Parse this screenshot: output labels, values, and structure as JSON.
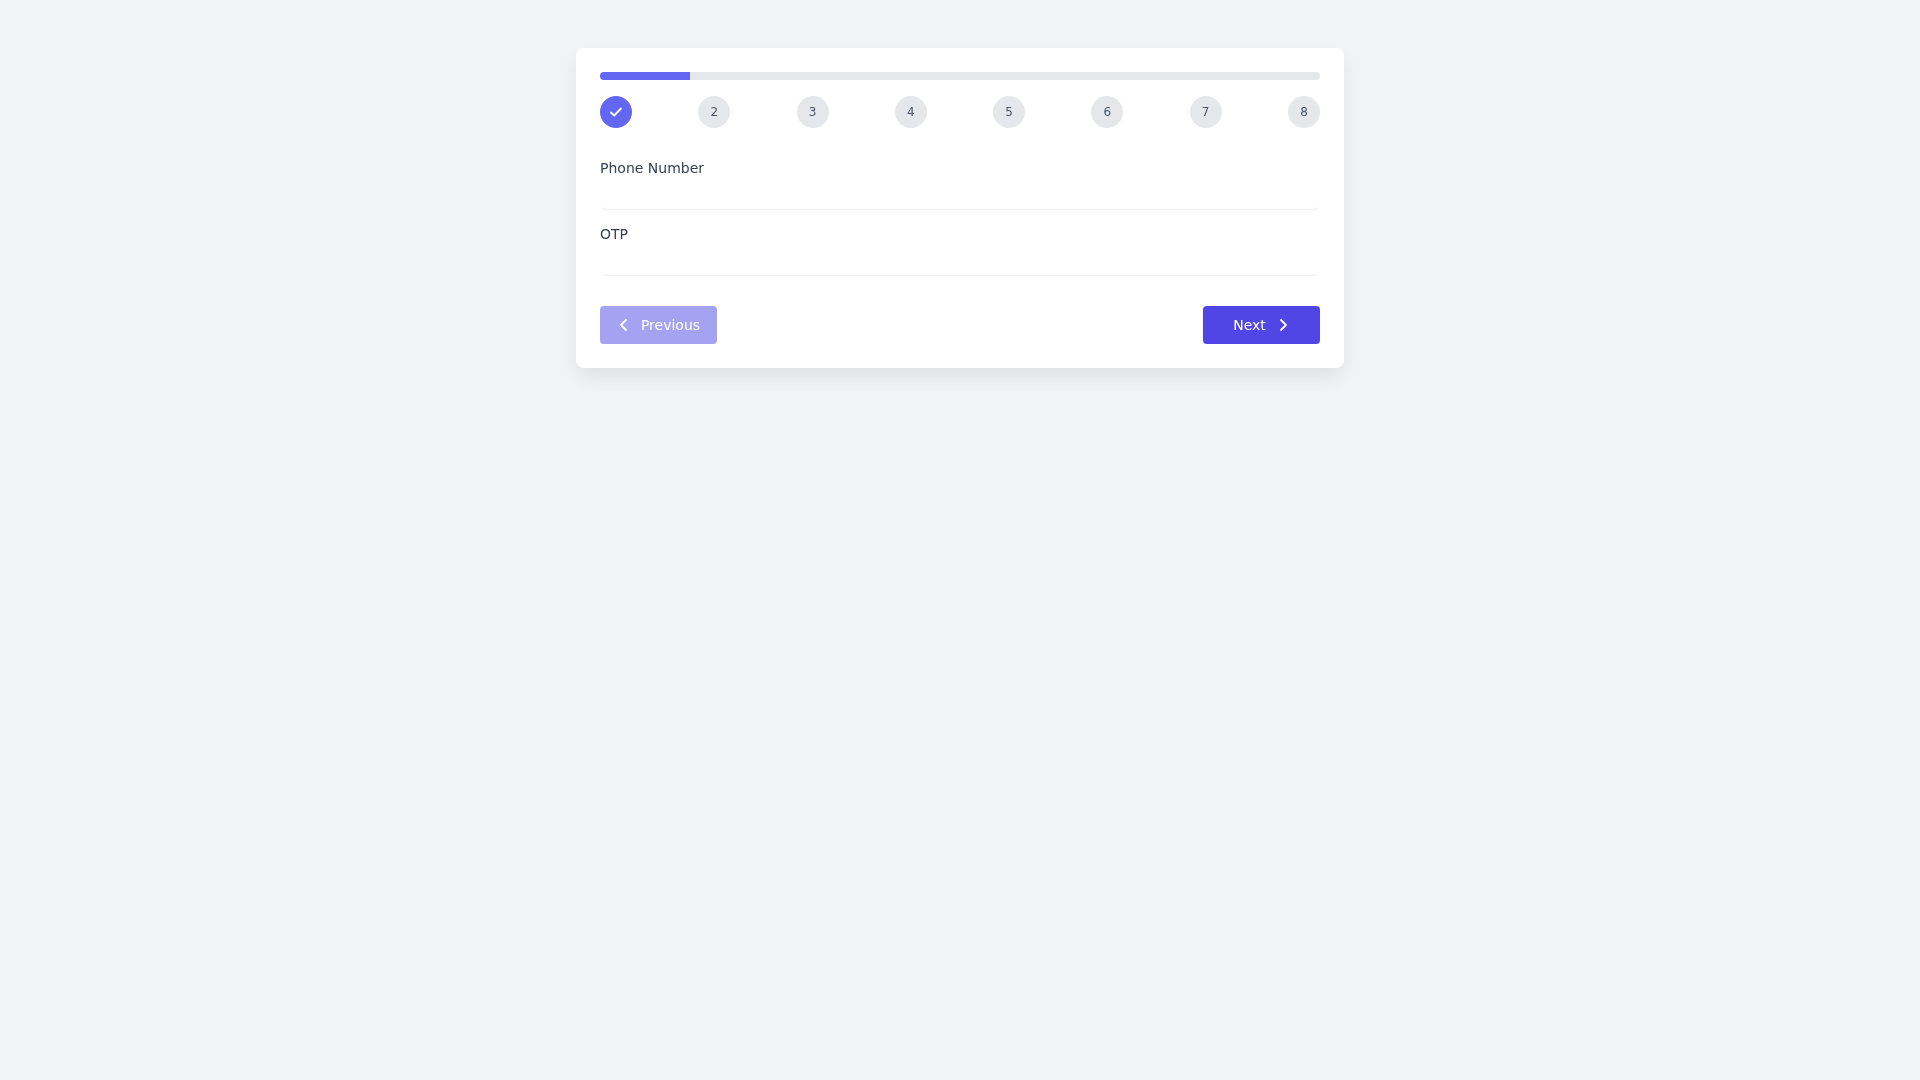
{
  "progress": {
    "level": 0.125
  },
  "steps": [
    {
      "completed": true
    },
    {
      "label": "2",
      "completed": false
    },
    {
      "label": "3",
      "completed": false
    },
    {
      "label": "4",
      "completed": false
    },
    {
      "label": "5",
      "completed": false
    },
    {
      "label": "6",
      "completed": false
    },
    {
      "label": "7",
      "completed": false
    },
    {
      "label": "8",
      "completed": false
    }
  ],
  "fields": [
    {
      "label": "Phone Number"
    },
    {
      "label": "OTP"
    }
  ],
  "previous_button": {
    "label": "Previous",
    "disabled": true
  },
  "next_button": {
    "label": "Next",
    "disabled": false
  }
}
